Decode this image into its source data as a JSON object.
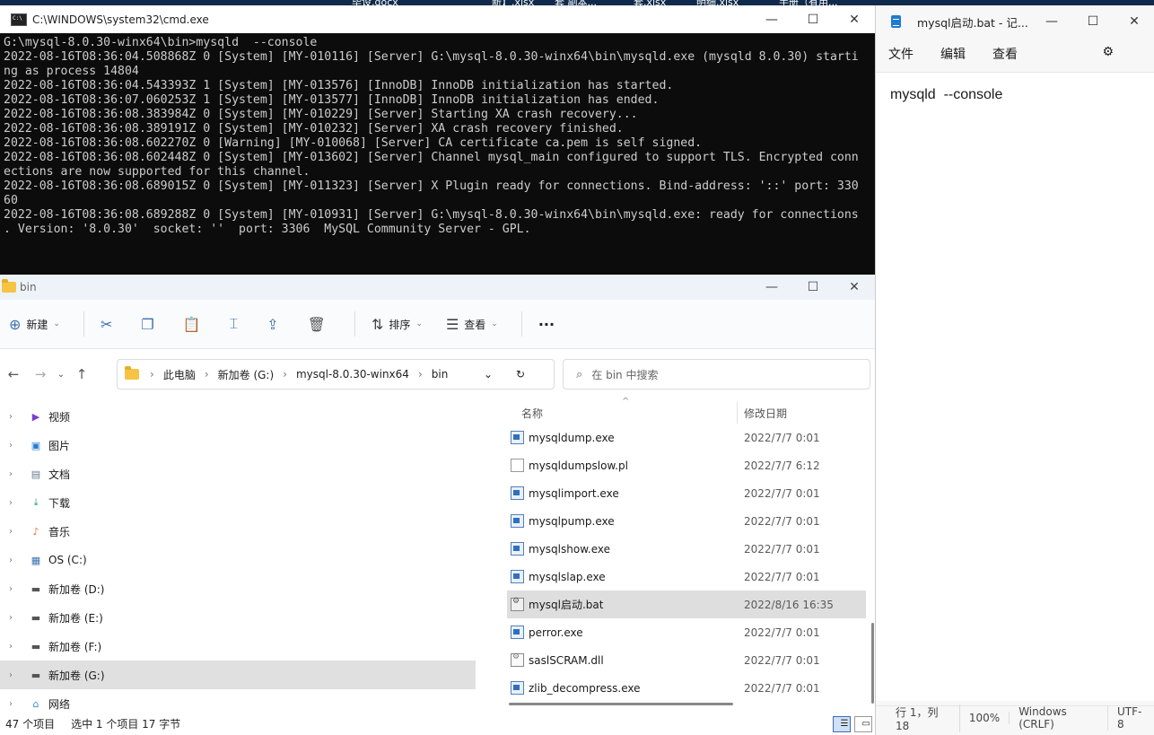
{
  "taskbar": {
    "items": [
      "毕设.docx",
      "新】.xlsx",
      "套 副本...",
      "套.xlsx",
      "明细.xlsx",
      "手册（有用..."
    ]
  },
  "cmd": {
    "title": "C:\\WINDOWS\\system32\\cmd.exe",
    "lines": [
      "G:\\mysql-8.0.30-winx64\\bin>mysqld  --console",
      "2022-08-16T08:36:04.508868Z 0 [System] [MY-010116] [Server] G:\\mysql-8.0.30-winx64\\bin\\mysqld.exe (mysqld 8.0.30) starti",
      "ng as process 14804",
      "2022-08-16T08:36:04.543393Z 1 [System] [MY-013576] [InnoDB] InnoDB initialization has started.",
      "2022-08-16T08:36:07.060253Z 1 [System] [MY-013577] [InnoDB] InnoDB initialization has ended.",
      "2022-08-16T08:36:08.383984Z 0 [System] [MY-010229] [Server] Starting XA crash recovery...",
      "2022-08-16T08:36:08.389191Z 0 [System] [MY-010232] [Server] XA crash recovery finished.",
      "2022-08-16T08:36:08.602270Z 0 [Warning] [MY-010068] [Server] CA certificate ca.pem is self signed.",
      "2022-08-16T08:36:08.602448Z 0 [System] [MY-013602] [Server] Channel mysql_main configured to support TLS. Encrypted conn",
      "ections are now supported for this channel.",
      "2022-08-16T08:36:08.689015Z 0 [System] [MY-011323] [Server] X Plugin ready for connections. Bind-address: '::' port: 330",
      "60",
      "2022-08-16T08:36:08.689288Z 0 [System] [MY-010931] [Server] G:\\mysql-8.0.30-winx64\\bin\\mysqld.exe: ready for connections",
      ". Version: '8.0.30'  socket: ''  port: 3306  MySQL Community Server - GPL."
    ]
  },
  "explorer": {
    "title": "bin",
    "toolbar": {
      "new": "新建",
      "sort": "排序",
      "view": "查看",
      "more": "···"
    },
    "breadcrumb": [
      "此电脑",
      "新加卷 (G:)",
      "mysql-8.0.30-winx64",
      "bin"
    ],
    "search_placeholder": "在 bin 中搜索",
    "tree": [
      {
        "label": "视频",
        "icon": "video-icon"
      },
      {
        "label": "图片",
        "icon": "picture-icon"
      },
      {
        "label": "文档",
        "icon": "document-icon"
      },
      {
        "label": "下载",
        "icon": "download-icon"
      },
      {
        "label": "音乐",
        "icon": "music-icon"
      },
      {
        "label": "OS (C:)",
        "icon": "windows-drive-icon"
      },
      {
        "label": "新加卷 (D:)",
        "icon": "drive-icon"
      },
      {
        "label": "新加卷 (E:)",
        "icon": "drive-icon"
      },
      {
        "label": "新加卷 (F:)",
        "icon": "drive-icon"
      },
      {
        "label": "新加卷 (G:)",
        "icon": "drive-icon"
      },
      {
        "label": "网络",
        "icon": "network-icon"
      }
    ],
    "columns": {
      "name": "名称",
      "date": "修改日期"
    },
    "files": [
      {
        "name": "mysqldump.exe",
        "date": "2022/7/7 0:01",
        "type": "exe"
      },
      {
        "name": "mysqldumpslow.pl",
        "date": "2022/7/7 6:12",
        "type": "txt"
      },
      {
        "name": "mysqlimport.exe",
        "date": "2022/7/7 0:01",
        "type": "exe"
      },
      {
        "name": "mysqlpump.exe",
        "date": "2022/7/7 0:01",
        "type": "exe"
      },
      {
        "name": "mysqlshow.exe",
        "date": "2022/7/7 0:01",
        "type": "exe"
      },
      {
        "name": "mysqlslap.exe",
        "date": "2022/7/7 0:01",
        "type": "exe"
      },
      {
        "name": "mysql启动.bat",
        "date": "2022/8/16 16:35",
        "type": "bat"
      },
      {
        "name": "perror.exe",
        "date": "2022/7/7 0:01",
        "type": "exe"
      },
      {
        "name": "saslSCRAM.dll",
        "date": "2022/7/7 0:01",
        "type": "dll"
      },
      {
        "name": "zlib_decompress.exe",
        "date": "2022/7/7 0:01",
        "type": "exe"
      }
    ],
    "status": {
      "count": "47 个项目",
      "selected": "选中 1 个项目  17 字节"
    }
  },
  "notepad": {
    "title": "mysql启动.bat - 记...",
    "menu": {
      "file": "文件",
      "edit": "编辑",
      "view": "查看"
    },
    "content": "mysqld  --console",
    "status": {
      "position": "行 1，列 18",
      "zoom": "100%",
      "eol": "Windows (CRLF)",
      "encoding": "UTF-8"
    }
  }
}
